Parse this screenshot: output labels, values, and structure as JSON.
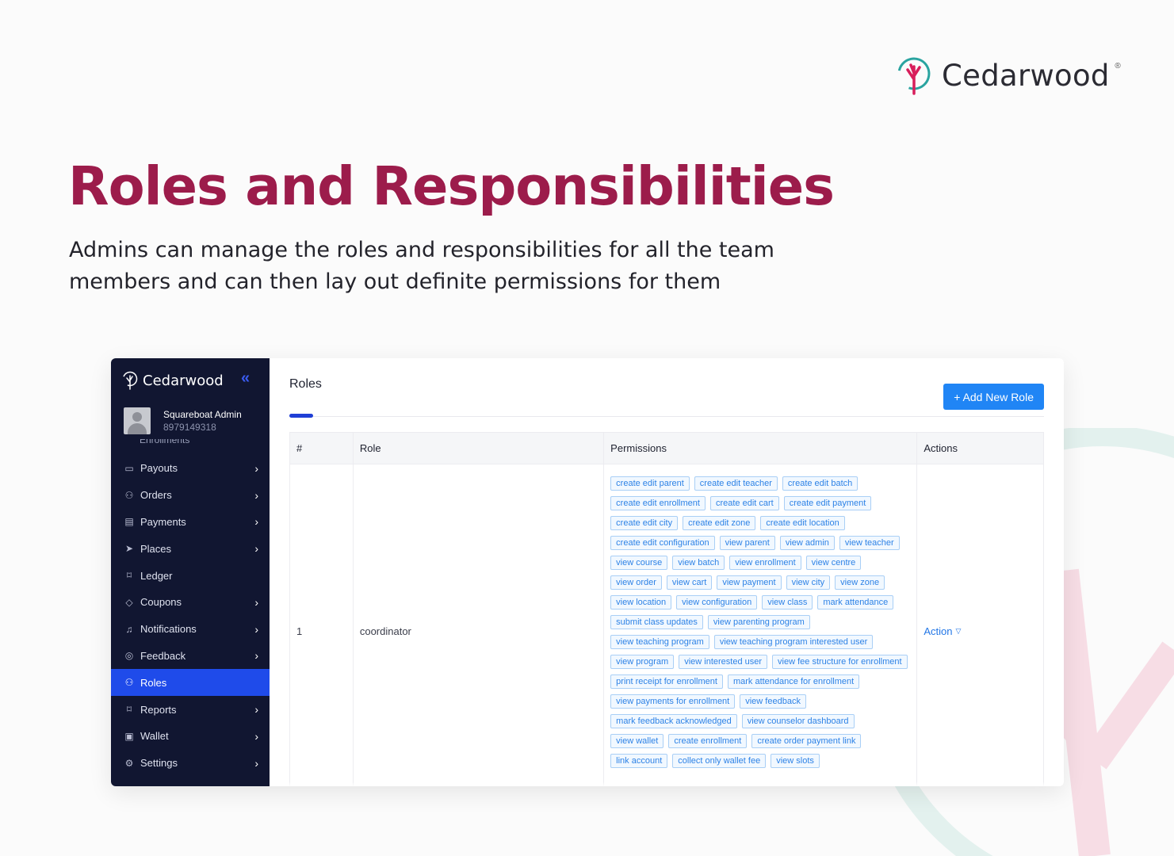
{
  "brand": {
    "name": "Cedarwood",
    "registered": "®"
  },
  "hero": {
    "title": "Roles and Responsibilities",
    "subtitle": "Admins can manage the roles and responsibilities for all the team members and can then lay out definite permissions for them"
  },
  "colors": {
    "accent": "#9c1c4b",
    "sidebar_bg": "#111631",
    "active": "#1f4bea",
    "button": "#2085f5",
    "tag_text": "#2d82e6"
  },
  "sidebar": {
    "logo_text": "Cedarwood",
    "collapse_icon": "double-chevron-left-icon",
    "user": {
      "name": "Squareboat Admin",
      "phone": "8979149318"
    },
    "hidden_item": "Enrollments",
    "items": [
      {
        "label": "Payouts",
        "icon": "card-icon",
        "has_chevron": true
      },
      {
        "label": "Orders",
        "icon": "user-icon",
        "has_chevron": true
      },
      {
        "label": "Payments",
        "icon": "credit-card-icon",
        "has_chevron": true
      },
      {
        "label": "Places",
        "icon": "location-arrow-icon",
        "has_chevron": true
      },
      {
        "label": "Ledger",
        "icon": "bookmark-icon",
        "has_chevron": false
      },
      {
        "label": "Coupons",
        "icon": "tag-icon",
        "has_chevron": true
      },
      {
        "label": "Notifications",
        "icon": "bell-icon",
        "has_chevron": true
      },
      {
        "label": "Feedback",
        "icon": "chat-icon",
        "has_chevron": true
      },
      {
        "label": "Roles",
        "icon": "user-icon",
        "has_chevron": false,
        "active": true
      },
      {
        "label": "Reports",
        "icon": "bookmark-icon",
        "has_chevron": true
      },
      {
        "label": "Wallet",
        "icon": "money-icon",
        "has_chevron": true
      },
      {
        "label": "Settings",
        "icon": "gear-icon",
        "has_chevron": true
      }
    ]
  },
  "main": {
    "title": "Roles",
    "add_button": "+ Add New Role",
    "table": {
      "headers": [
        "#",
        "Role",
        "Permissions",
        "Actions"
      ],
      "rows": [
        {
          "index": "1",
          "role": "coordinator",
          "action": "Action",
          "permissions": [
            "create edit parent",
            "create edit teacher",
            "create edit batch",
            "create edit enrollment",
            "create edit cart",
            "create edit payment",
            "create edit city",
            "create edit zone",
            "create edit location",
            "create edit configuration",
            "view parent",
            "view admin",
            "view teacher",
            "view course",
            "view batch",
            "view enrollment",
            "view centre",
            "view order",
            "view cart",
            "view payment",
            "view city",
            "view zone",
            "view location",
            "view configuration",
            "view class",
            "mark attendance",
            "submit class updates",
            "view parenting program",
            "view teaching program",
            "view teaching program interested user",
            "view program",
            "view interested user",
            "view fee structure for enrollment",
            "print receipt for enrollment",
            "mark attendance for enrollment",
            "view payments for enrollment",
            "view feedback",
            "mark feedback acknowledged",
            "view counselor dashboard",
            "view wallet",
            "create enrollment",
            "create order payment link",
            "link account",
            "collect only wallet fee",
            "view slots"
          ]
        }
      ]
    }
  }
}
